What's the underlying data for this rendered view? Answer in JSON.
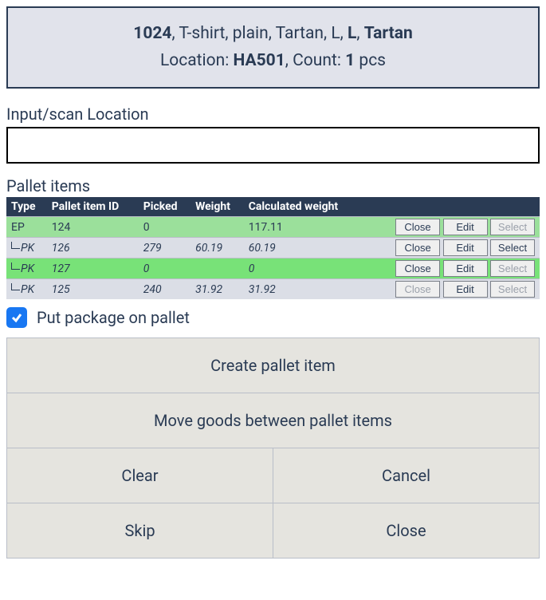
{
  "info": {
    "sku": "1024",
    "desc_parts": ", T-shirt, plain, Tartan, L, ",
    "bold2": "L",
    "desc_parts2": ", ",
    "bold3": "Tartan",
    "loc_prefix": "Location: ",
    "location": "HA501",
    "loc_suffix": ", Count: ",
    "count": "1",
    "loc_unit": " pcs"
  },
  "input": {
    "label": "Input/scan Location",
    "value": ""
  },
  "pallet": {
    "label": "Pallet items",
    "headers": {
      "type": "Type",
      "id": "Pallet item ID",
      "picked": "Picked",
      "weight": "Weight",
      "calc": "Calculated weight"
    },
    "btn": {
      "close": "Close",
      "edit": "Edit",
      "select": "Select"
    },
    "rows": [
      {
        "type": "EP",
        "child": false,
        "id": "124",
        "picked": "0",
        "weight": "",
        "calc": "117.11",
        "row_style": "row-green-light",
        "italic": false,
        "close_enabled": true,
        "edit_enabled": true,
        "select_enabled": false
      },
      {
        "type": "PK",
        "child": true,
        "id": "126",
        "picked": "279",
        "weight": "60.19",
        "calc": "60.19",
        "row_style": "row-gray",
        "italic": true,
        "close_enabled": true,
        "edit_enabled": true,
        "select_enabled": true
      },
      {
        "type": "PK",
        "child": true,
        "id": "127",
        "picked": "0",
        "weight": "",
        "calc": "0",
        "row_style": "row-green-bright",
        "italic": true,
        "close_enabled": true,
        "edit_enabled": true,
        "select_enabled": false
      },
      {
        "type": "PK",
        "child": true,
        "id": "125",
        "picked": "240",
        "weight": "31.92",
        "calc": "31.92",
        "row_style": "row-gray",
        "italic": true,
        "close_enabled": false,
        "edit_enabled": true,
        "select_enabled": false
      }
    ]
  },
  "checkbox": {
    "checked": true,
    "label": "Put package on pallet"
  },
  "buttons": {
    "create": "Create pallet item",
    "move": "Move goods between pallet items",
    "clear": "Clear",
    "cancel": "Cancel",
    "skip": "Skip",
    "close": "Close"
  }
}
